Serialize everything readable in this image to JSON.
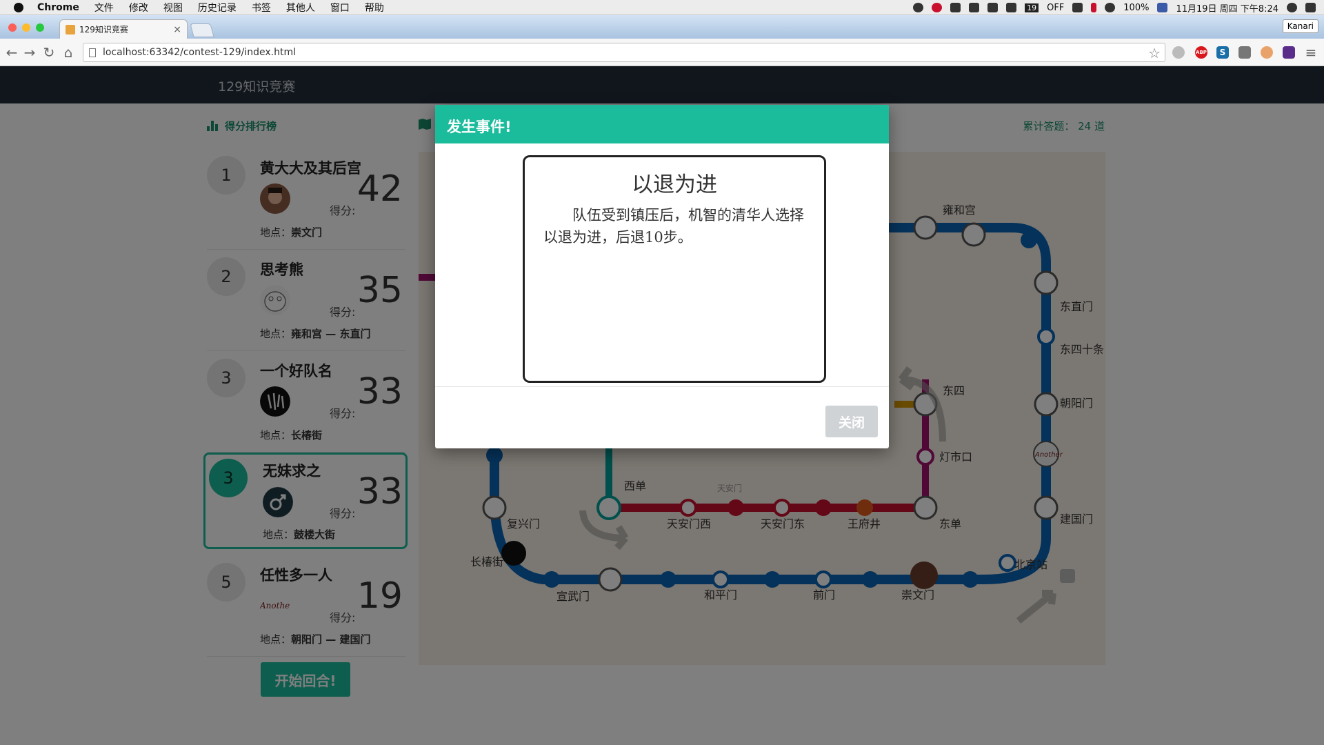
{
  "os_menubar": {
    "app_name": "Chrome",
    "menus": [
      "文件",
      "修改",
      "视图",
      "历史记录",
      "书签",
      "其他人",
      "窗口",
      "帮助"
    ],
    "badge_count": "19",
    "toggle_label": "OFF",
    "battery": "100%",
    "clock": "11月19日 周四 下午8:24"
  },
  "browser": {
    "tab_title": "129知识竞赛",
    "tab_close": "×",
    "profile_name": "Kanari",
    "url": "localhost:63342/contest-129/index.html",
    "ext_abp": "ABP",
    "ext_s": "S"
  },
  "page": {
    "brand": "129知识竞赛",
    "ranking_title": "得分排行榜",
    "total_label": "累计答题：",
    "total_value": "24 道",
    "score_label": "得分:",
    "location_label": "地点：",
    "start_button": "开始回合!"
  },
  "ranking": [
    {
      "rank": "1",
      "name": "黄大大及其后宫",
      "score": "42",
      "location": "崇文门",
      "avatar": "face-avatar"
    },
    {
      "rank": "2",
      "name": "思考熊",
      "score": "35",
      "location": "雍和宫 — 东直门",
      "avatar": "bear-avatar"
    },
    {
      "rank": "3",
      "name": "一个好队名",
      "score": "33",
      "location": "长椿街",
      "avatar": "calligraphy-avatar"
    },
    {
      "rank": "3",
      "name": "无妹求之",
      "score": "33",
      "location": "鼓楼大街",
      "avatar": "male-symbol-avatar"
    },
    {
      "rank": "5",
      "name": "任性多一人",
      "score": "19",
      "location": "朝阳门 — 建国门",
      "avatar": "another-avatar",
      "avatar_text": "Another"
    }
  ],
  "map": {
    "stations": [
      "雍和宫",
      "东直门",
      "东四十条",
      "朝阳门",
      "建国门",
      "北京站",
      "东四",
      "灯市口",
      "东单",
      "王府井",
      "天安门东",
      "天安门西",
      "西单",
      "复兴门",
      "长椿街",
      "宣武门",
      "和平门",
      "前门",
      "崇文门"
    ],
    "landmark": "天安门",
    "marker_text": "Another",
    "colors": {
      "line2": "#0a64b4",
      "line1": "#c8102e",
      "line4": "#00a19a",
      "line5": "#a1126e",
      "line6": "#d29700"
    }
  },
  "modal": {
    "header": "发生事件!",
    "event_title": "以退为进",
    "event_description": "队伍受到镇压后，机智的清华人选择以退为进，后退10步。",
    "close_button": "关闭"
  },
  "colors": {
    "accent": "#1abc9c",
    "navbar": "#222d3a",
    "overlay": "rgba(0,0,0,0.5)"
  }
}
